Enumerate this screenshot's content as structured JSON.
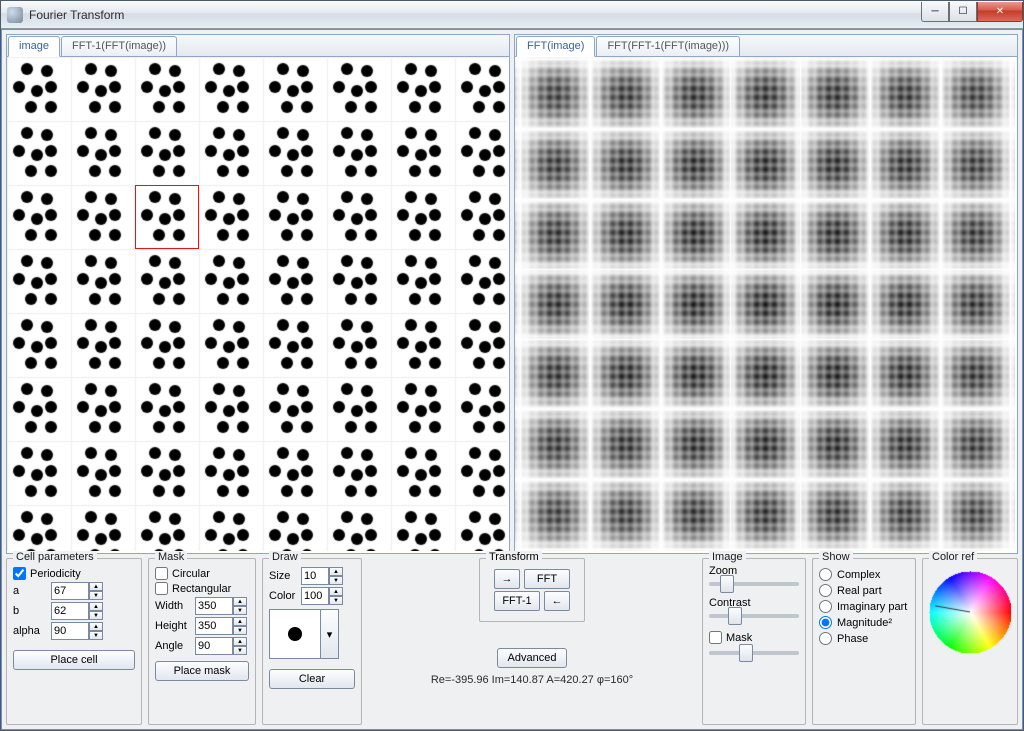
{
  "window": {
    "title": "Fourier Transform"
  },
  "tabs": {
    "left": [
      {
        "label": "image",
        "active": true
      },
      {
        "label": "FFT-1(FFT(image))",
        "active": false
      }
    ],
    "right": [
      {
        "label": "FFT(image)",
        "active": true
      },
      {
        "label": "FFT(FFT-1(FFT(image)))",
        "active": false
      }
    ]
  },
  "cell": {
    "legend": "Cell parameters",
    "periodicity": {
      "label": "Periodicity",
      "checked": true
    },
    "a": {
      "label": "a",
      "value": "67"
    },
    "b": {
      "label": "b",
      "value": "62"
    },
    "alpha": {
      "label": "alpha",
      "value": "90"
    },
    "place": "Place cell"
  },
  "mask": {
    "legend": "Mask",
    "circular": {
      "label": "Circular",
      "checked": false
    },
    "rectangular": {
      "label": "Rectangular",
      "checked": false
    },
    "width": {
      "label": "Width",
      "value": "350"
    },
    "height": {
      "label": "Height",
      "value": "350"
    },
    "angle": {
      "label": "Angle",
      "value": "90"
    },
    "place": "Place mask"
  },
  "draw": {
    "legend": "Draw",
    "size": {
      "label": "Size",
      "value": "10"
    },
    "color": {
      "label": "Color",
      "value": "100"
    },
    "clear": "Clear"
  },
  "transform": {
    "legend": "Transform",
    "fft": "FFT",
    "ifft": "FFT-1",
    "advanced": "Advanced",
    "status": "Re=-395.96 Im=140.87 A=420.27 φ=160°"
  },
  "image": {
    "legend": "Image",
    "zoom": "Zoom",
    "contrast": "Contrast",
    "mask": {
      "label": "Mask",
      "checked": false
    }
  },
  "show": {
    "legend": "Show",
    "options": [
      {
        "label": "Complex",
        "checked": false
      },
      {
        "label": "Real part",
        "checked": false
      },
      {
        "label": "Imaginary part",
        "checked": false
      },
      {
        "label": "Magnitude²",
        "checked": true
      },
      {
        "label": "Phase",
        "checked": false
      }
    ]
  },
  "colorref": {
    "legend": "Color ref"
  },
  "dot_pattern": {
    "cell": 64,
    "dots_in_cell": [
      [
        20,
        12
      ],
      [
        40,
        14
      ],
      [
        12,
        30
      ],
      [
        30,
        34
      ],
      [
        44,
        30
      ],
      [
        24,
        50
      ],
      [
        44,
        50
      ]
    ],
    "sel_cell": [
      2,
      2
    ]
  }
}
